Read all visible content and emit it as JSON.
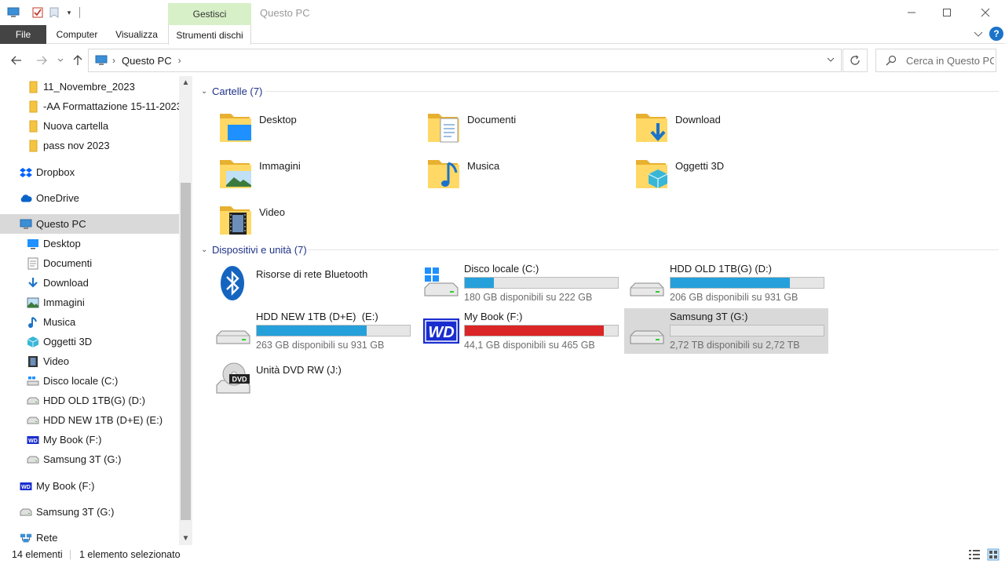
{
  "window": {
    "title": "Questo PC",
    "context_tab": "Gestisci",
    "controls": {
      "minimize": "—",
      "maximize": "☐",
      "close": "✕"
    }
  },
  "ribbon": {
    "tabs": [
      "File",
      "Computer",
      "Visualizza",
      "Strumenti dischi"
    ],
    "help": "?"
  },
  "address": {
    "path": "Questo PC",
    "search_placeholder": "Cerca in Questo PC"
  },
  "sidebar": {
    "items": [
      {
        "label": "11_Novembre_2023",
        "icon": "folder-icon"
      },
      {
        "label": "-AA Formattazione 15-11-2023",
        "icon": "folder-icon"
      },
      {
        "label": "Nuova cartella",
        "icon": "folder-icon"
      },
      {
        "label": "pass nov 2023",
        "icon": "folder-icon"
      },
      {
        "label": "Dropbox",
        "icon": "dropbox-icon"
      },
      {
        "label": "OneDrive",
        "icon": "onedrive-icon"
      },
      {
        "label": "Questo PC",
        "icon": "pc-icon"
      },
      {
        "label": "Desktop",
        "icon": "desktop-icon"
      },
      {
        "label": "Documenti",
        "icon": "documents-icon"
      },
      {
        "label": "Download",
        "icon": "download-icon"
      },
      {
        "label": "Immagini",
        "icon": "pictures-icon"
      },
      {
        "label": "Musica",
        "icon": "music-icon"
      },
      {
        "label": "Oggetti 3D",
        "icon": "3d-objects-icon"
      },
      {
        "label": "Video",
        "icon": "video-icon"
      },
      {
        "label": "Disco locale (C:)",
        "icon": "windows-drive-icon"
      },
      {
        "label": "HDD OLD 1TB(G) (D:)",
        "icon": "drive-icon"
      },
      {
        "label": "HDD NEW 1TB (D+E)  (E:)",
        "icon": "drive-icon"
      },
      {
        "label": "My Book (F:)",
        "icon": "wd-drive-icon"
      },
      {
        "label": "Samsung 3T (G:)",
        "icon": "drive-icon"
      },
      {
        "label": "My Book (F:)",
        "icon": "wd-drive-icon"
      },
      {
        "label": "Samsung 3T (G:)",
        "icon": "drive-icon"
      },
      {
        "label": "Rete",
        "icon": "network-icon"
      }
    ]
  },
  "content": {
    "folders_header": "Cartelle (7)",
    "folders": [
      {
        "label": "Desktop",
        "icon": "desktop-folder-icon"
      },
      {
        "label": "Documenti",
        "icon": "documents-folder-icon"
      },
      {
        "label": "Download",
        "icon": "download-folder-icon"
      },
      {
        "label": "Immagini",
        "icon": "pictures-folder-icon"
      },
      {
        "label": "Musica",
        "icon": "music-folder-icon"
      },
      {
        "label": "Oggetti 3D",
        "icon": "3d-objects-folder-icon"
      },
      {
        "label": "Video",
        "icon": "video-folder-icon"
      }
    ],
    "devices_header": "Dispositivi e unità (7)",
    "devices": [
      {
        "label": "Risorse di rete Bluetooth",
        "icon": "bluetooth-icon"
      },
      {
        "label": "Disco locale (C:)",
        "free": "180 GB disponibili su 222 GB",
        "used_fraction": 0.19,
        "bar_color": "#26a0da",
        "icon": "windows-drive-icon"
      },
      {
        "label": "HDD OLD 1TB(G) (D:)",
        "free": "206 GB disponibili su 931 GB",
        "used_fraction": 0.78,
        "bar_color": "#26a0da",
        "icon": "drive-icon"
      },
      {
        "label": "HDD NEW 1TB (D+E)  (E:)",
        "free": "263 GB disponibili su 931 GB",
        "used_fraction": 0.72,
        "bar_color": "#26a0da",
        "icon": "drive-icon"
      },
      {
        "label": "My Book (F:)",
        "free": "44,1 GB disponibili su 465 GB",
        "used_fraction": 0.91,
        "bar_color": "#da2626",
        "icon": "wd-drive-icon"
      },
      {
        "label": "Samsung 3T (G:)",
        "free": "2,72 TB disponibili su 2,72 TB",
        "used_fraction": 0.0,
        "bar_color": "#26a0da",
        "icon": "drive-icon"
      },
      {
        "label": "Unità DVD RW (J:)",
        "icon": "dvd-drive-icon"
      }
    ]
  },
  "status": {
    "count": "14 elementi",
    "selected": "1 elemento selezionato"
  }
}
